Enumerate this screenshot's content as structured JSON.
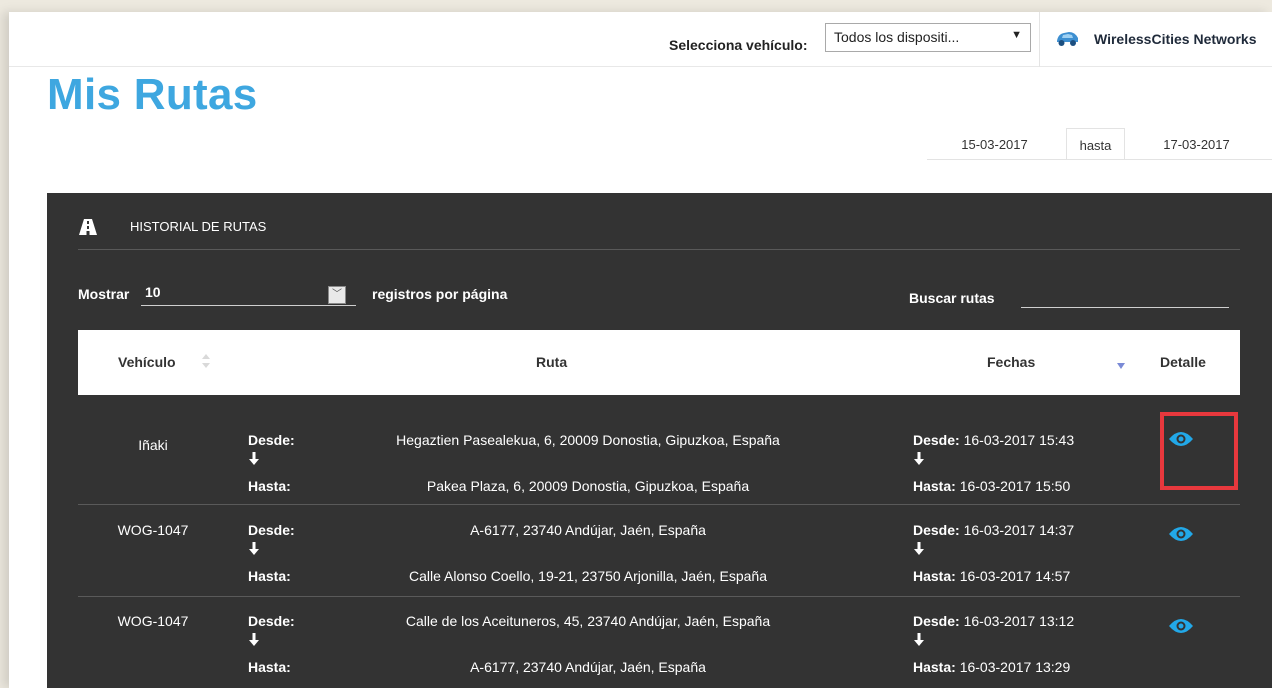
{
  "topbar": {
    "vehicle_label": "Selecciona vehículo:",
    "vehicle_select_value": "Todos los dispositi...",
    "company_name": "WirelessCities Networks"
  },
  "page": {
    "title": "Mis Rutas"
  },
  "date_range": {
    "from": "15-03-2017",
    "separator": "hasta",
    "to": "17-03-2017"
  },
  "panel": {
    "title": "HISTORIAL DE RUTAS",
    "show_label": "Mostrar",
    "show_value": "10",
    "per_page_label": "registros por página",
    "search_label": "Buscar rutas",
    "search_value": ""
  },
  "table": {
    "columns": {
      "vehicle": "Vehículo",
      "route": "Ruta",
      "dates": "Fechas",
      "detail": "Detalle"
    },
    "from_label": "Desde:",
    "to_label": "Hasta:",
    "rows": [
      {
        "vehicle": "Iñaki",
        "from_address": "Hegaztien Pasealekua, 6, 20009 Donostia, Gipuzkoa, España",
        "to_address": "Pakea Plaza, 6, 20009 Donostia, Gipuzkoa, España",
        "from_date": "16-03-2017 15:43",
        "to_date": "16-03-2017 15:50"
      },
      {
        "vehicle": "WOG-1047",
        "from_address": "A-6177, 23740 Andújar, Jaén, España",
        "to_address": "Calle Alonso Coello, 19-21, 23750 Arjonilla, Jaén, España",
        "from_date": "16-03-2017 14:37",
        "to_date": "16-03-2017 14:57"
      },
      {
        "vehicle": "WOG-1047",
        "from_address": "Calle de los Aceituneros, 45, 23740 Andújar, Jaén, España",
        "to_address": "A-6177, 23740 Andújar, Jaén, España",
        "from_date": "16-03-2017 13:12",
        "to_date": "16-03-2017 13:29"
      }
    ]
  },
  "colors": {
    "title": "#3ea7e0",
    "panel_bg": "#333333",
    "eye_icon": "#22a8e8",
    "highlight": "#e8383d"
  }
}
